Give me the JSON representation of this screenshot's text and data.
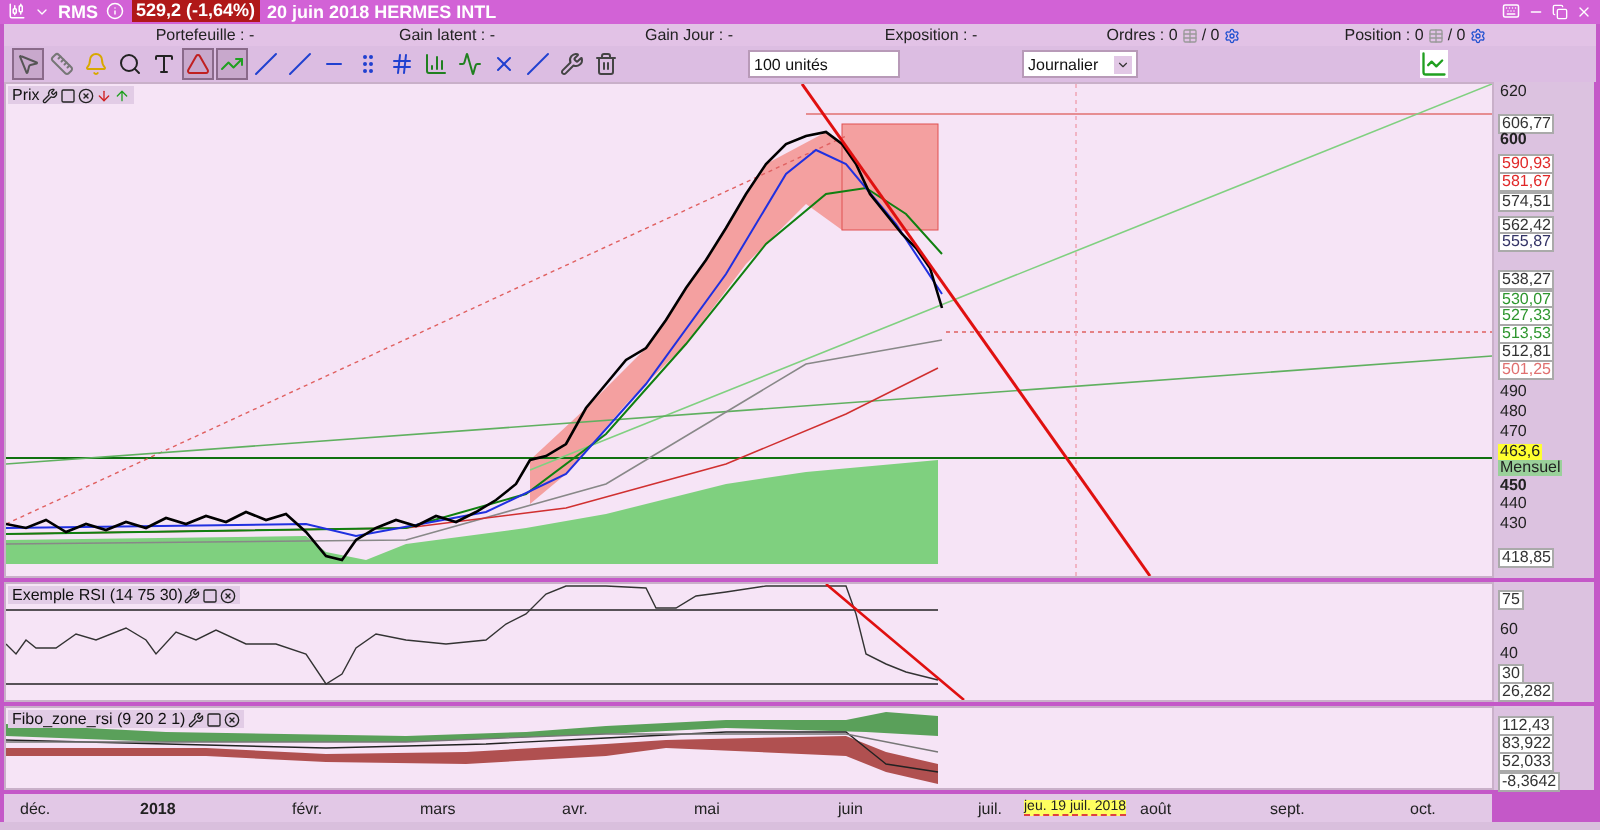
{
  "title_bar": {
    "symbol": "RMS",
    "price": "529,2 (-1,64%)",
    "description": "20 juin 2018 HERMES INTL"
  },
  "info_bar": [
    {
      "kind": "field",
      "label": "Portefeuille : -"
    },
    {
      "kind": "field",
      "label": "Gain latent : -"
    },
    {
      "kind": "field",
      "label": "Gain Jour : -"
    },
    {
      "kind": "field",
      "label": "Exposition : -"
    },
    {
      "kind": "counter",
      "label": "Ordres : 0",
      "total": "/ 0"
    },
    {
      "kind": "counter",
      "label": "Position : 0",
      "total": "/ 0"
    }
  ],
  "toolbar": {
    "tools": [
      {
        "kind": "pointer",
        "selected": true
      },
      {
        "kind": "ruler",
        "selected": false
      },
      {
        "kind": "alert",
        "selected": false
      },
      {
        "kind": "zoom",
        "selected": false
      },
      {
        "kind": "text",
        "selected": false
      },
      {
        "kind": "fan",
        "selected": true
      },
      {
        "kind": "channel",
        "selected": true
      },
      {
        "kind": "segment",
        "selected": false
      },
      {
        "kind": "line",
        "selected": false
      },
      {
        "kind": "horizontal",
        "selected": false
      },
      {
        "kind": "vertical",
        "selected": false
      },
      {
        "kind": "parallel",
        "selected": false
      },
      {
        "kind": "bars",
        "selected": false
      },
      {
        "kind": "wave",
        "selected": false
      },
      {
        "kind": "cross",
        "selected": false
      },
      {
        "kind": "ray",
        "selected": false
      },
      {
        "kind": "tools",
        "selected": false
      },
      {
        "kind": "trash",
        "selected": false
      }
    ],
    "quantity": "100 unités",
    "period": "Journalier"
  },
  "panels": [
    {
      "kind": "price",
      "title": "Prix",
      "axis": [
        {
          "label": "620",
          "kind": "tick"
        },
        {
          "label": "606,77",
          "kind": "tag",
          "color": "#333333"
        },
        {
          "label": "600",
          "kind": "major"
        },
        {
          "label": "590,93",
          "kind": "tag",
          "color": "#e02828"
        },
        {
          "label": "581,67",
          "kind": "tag",
          "color": "#e02828"
        },
        {
          "label": "574,51",
          "kind": "tag",
          "color": "#333333"
        },
        {
          "label": "562,42",
          "kind": "tag",
          "color": "#333333"
        },
        {
          "label": "555,87",
          "kind": "tag",
          "color": "#333366"
        },
        {
          "label": "538,27",
          "kind": "tag",
          "color": "#333333"
        },
        {
          "label": "530,07",
          "kind": "tag",
          "color": "#2e962e"
        },
        {
          "label": "527,33",
          "kind": "tag",
          "color": "#2e962e"
        },
        {
          "label": "513,53",
          "kind": "tag",
          "color": "#2e962e"
        },
        {
          "label": "512,81",
          "kind": "tag",
          "color": "#333333"
        },
        {
          "label": "501,25",
          "kind": "tag",
          "color": "#e07070"
        },
        {
          "label": "490",
          "kind": "tick"
        },
        {
          "label": "480",
          "kind": "tick"
        },
        {
          "label": "470",
          "kind": "tick"
        },
        {
          "label": "463,6",
          "kind": "current"
        },
        {
          "label": "Mensuel",
          "kind": "note"
        },
        {
          "label": "450",
          "kind": "major"
        },
        {
          "label": "440",
          "kind": "tick"
        },
        {
          "label": "430",
          "kind": "tick"
        },
        {
          "label": "418,85",
          "kind": "tag",
          "color": "#333333"
        }
      ]
    },
    {
      "kind": "rsi",
      "title": "Exemple RSI (14 75 30)",
      "axis": [
        {
          "label": "75",
          "kind": "tag",
          "color": "#333333"
        },
        {
          "label": "60",
          "kind": "tick"
        },
        {
          "label": "40",
          "kind": "tick"
        },
        {
          "label": "30",
          "kind": "tag",
          "color": "#333333"
        },
        {
          "label": "26,282",
          "kind": "tag",
          "color": "#333333"
        }
      ]
    },
    {
      "kind": "fibo",
      "title": "Fibo_zone_rsi (9 20 2 1)",
      "axis": [
        {
          "label": "112,43",
          "kind": "tag",
          "color": "#333333"
        },
        {
          "label": "83,922",
          "kind": "tag",
          "color": "#333333"
        },
        {
          "label": "52,033",
          "kind": "tag",
          "color": "#333333"
        },
        {
          "label": "-8,3642",
          "kind": "tag",
          "color": "#333333"
        }
      ]
    }
  ],
  "date_axis": [
    {
      "label": "déc.",
      "kind": "month"
    },
    {
      "label": "2018",
      "kind": "year"
    },
    {
      "label": "févr.",
      "kind": "month"
    },
    {
      "label": "mars",
      "kind": "month"
    },
    {
      "label": "avr.",
      "kind": "month"
    },
    {
      "label": "mai",
      "kind": "month"
    },
    {
      "label": "juin",
      "kind": "month"
    },
    {
      "label": "juil.",
      "kind": "month"
    },
    {
      "label": "jeu. 19 juil. 2018",
      "kind": "cursor"
    },
    {
      "label": "août",
      "kind": "month"
    },
    {
      "label": "sept.",
      "kind": "month"
    },
    {
      "label": "oct.",
      "kind": "month"
    }
  ]
}
